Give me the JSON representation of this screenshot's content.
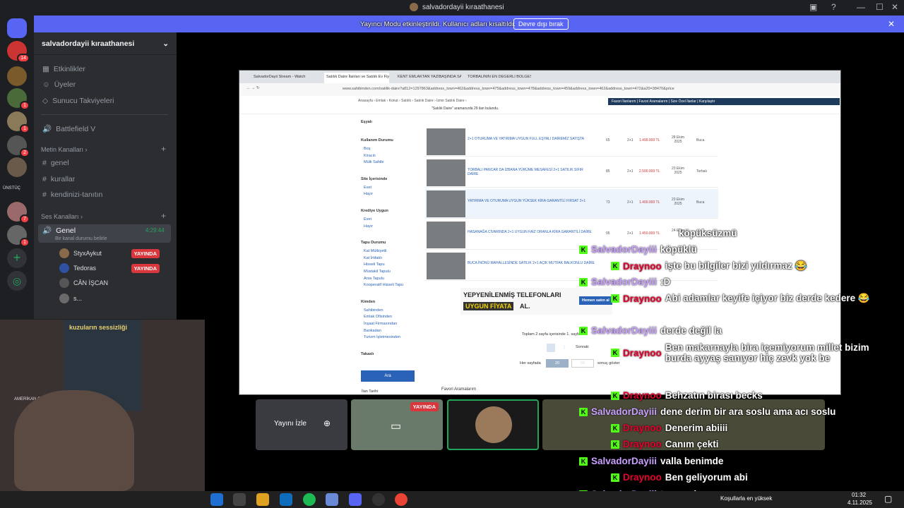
{
  "window": {
    "title": "salvadordayii kıraathanesi"
  },
  "banner": {
    "message": "Yayıncı Modu etkinleştirildi. Kullanıcı adları kısaltıldı.",
    "button": "Devre dışı bırak"
  },
  "servers": {
    "badges": [
      "14",
      "1",
      "1",
      "1",
      "2",
      "1",
      "7",
      "1"
    ],
    "server_label": "ÜNSTÜÇ"
  },
  "sidebar": {
    "server_name": "salvadordayii kıraathanesi",
    "items": [
      {
        "label": "Etkinlikler",
        "icon": "calendar-icon"
      },
      {
        "label": "Üyeler",
        "icon": "members-icon"
      },
      {
        "label": "Sunucu Takviyeleri",
        "icon": "boost-icon"
      }
    ],
    "game": "Battlefield V",
    "text_category": "Metin Kanalları",
    "text_channels": [
      "genel",
      "kurallar",
      "kendinizi-tanıtın"
    ],
    "voice_category": "Ses Kanalları",
    "voice_channel": {
      "name": "Genel",
      "time": "4:29:44",
      "status": "Bir kanal durumu belirle"
    },
    "voice_users": [
      {
        "name": "StyxAykut",
        "live": "YAYINDA"
      },
      {
        "name": "Tedoras",
        "live": "YAYINDA"
      },
      {
        "name": "CÂN İŞCAN",
        "live": ""
      },
      {
        "name": "s...",
        "live": ""
      }
    ]
  },
  "shared_screen": {
    "tabs": [
      "SalvadorDayii Stream - Watch",
      "Satılık Daire İlanları ve Satılık Ev Fiyat",
      "KENT EMLAKTAN YAZIBAŞINDA SATI",
      "TORBALININ EN DEĞERLİ BÖLGESİ"
    ],
    "url": "www.sahibinden.com/satilik-daire?a812=1297863&address_town=462&address_town=475&address_town=478&address_town=459&address_town=462&address_town=472&a20=38470&price",
    "breadcrumb": "Anasayfa › Emlak › Konut › Satılık › Satılık Daire › İzmir Satılık Daire ›",
    "result_text": "\"Satılık Daire\" aramanızda 29 ilan bulundu.",
    "top_links": "Favori İlanlarım | Favori Aramalarım | Size Özel İlanlar | Karşılaştır",
    "filters": [
      {
        "title": "Eşyalı",
        "options": []
      },
      {
        "title": "Kullanım Durumu",
        "options": [
          "Boş",
          "Kiracılı",
          "Mülk Sahibi"
        ]
      },
      {
        "title": "Site İçerisinde",
        "options": [
          "Evet",
          "Hayır"
        ]
      },
      {
        "title": "Krediye Uygun",
        "options": [
          "Evet",
          "Hayır"
        ]
      },
      {
        "title": "Tapu Durumu",
        "options": [
          "Kat Mülkiyetli",
          "Kat İrtifaklı",
          "Hisseli Tapu",
          "Müstakil Tapulu",
          "Arsa Tapulu",
          "Kooperatif Hisseli Tapu"
        ]
      },
      {
        "title": "Kimden",
        "options": [
          "Sahibinden",
          "Emlak Ofisinden",
          "İnşaat Firmasından",
          "Bankadan",
          "Turizm İşletmesinden"
        ]
      },
      {
        "title": "Takaslı",
        "options": []
      }
    ],
    "search_button": "Ara",
    "last_filter": "İlan Tarihi",
    "listings": [
      {
        "title": "2+1 OTURUMA VE YATIRIMA UYGUN FULL EŞYALI DAİREMİZ SATIŞTA",
        "m2": "65",
        "rooms": "2+1",
        "price": "1.499.000 TL",
        "date": "28 Ekim 2025",
        "loc": "Buca"
      },
      {
        "title": "TORBALI PANCAR DA İZBANA YÜRÜME MESAFESİ 2+1 SATILIK SIFIR DAİRE",
        "m2": "85",
        "rooms": "2+1",
        "price": "2.500.000 TL",
        "date": "23 Ekim 2025",
        "loc": "Torbalı"
      },
      {
        "title": "YATIRIMA VE OTURUMA UYGUN YÜKSEK KİRA GARANTİLİ FIRSAT 2+1",
        "m2": "73",
        "rooms": "2+1",
        "price": "1.400.000 TL",
        "date": "23 Ekim 2025",
        "loc": "Buca"
      },
      {
        "title": "HASANAĞA CİVARINDA 2+1 UYGUN FAİZ ORANLA KİRA GARANTİLİ DAİRE",
        "m2": "95",
        "rooms": "2+1",
        "price": "1.450.000 TL",
        "date": "24 Ekim",
        "loc": ""
      },
      {
        "title": "BUCA İNÖNÜ MAHALLESİNDE SATILIK 2+1 AÇIK MUTFAK BALKONLU DAİRE",
        "m2": "",
        "rooms": "",
        "price": "",
        "date": "",
        "loc": ""
      }
    ],
    "ad": {
      "line1": "YEPYENİLENMİŞ TELEFONLARI",
      "line2": "UYGUN FİYATA",
      "line3": "AL.",
      "button": "Hemen satın al",
      "brand": "yepy"
    },
    "pagination": {
      "summary": "Toplam 2 sayfa içerisinde 1. sayfa",
      "pages": [
        "1",
        "2"
      ],
      "next": "Sonraki",
      "per_page_label": "Her sayfada",
      "per_page": [
        "20",
        "50"
      ],
      "per_page_suffix": "sonuç göster"
    },
    "footer": "Favori Aramalarım"
  },
  "tiles": {
    "watch_label": "Yayını İzle",
    "live_badge": "YAYINDA"
  },
  "chat": [
    {
      "user": "",
      "text": "köpüksüzmü",
      "color": "#ffffff"
    },
    {
      "user": "SalvadorDayiii",
      "text": "köpüklü",
      "color": "#c9a0ff"
    },
    {
      "user": "Draynoo",
      "text": "işte bu bilgiler bizi yıldırmaz 😂",
      "color": "#e8002d"
    },
    {
      "user": "SalvadorDayiii",
      "text": ":D",
      "color": "#c9a0ff"
    },
    {
      "user": "Draynoo",
      "text": "Abi adamlar keyife içiyor biz derde kedere 😂",
      "color": "#e8002d"
    },
    {
      "user": "SalvadorDayiii",
      "text": "derde değil la",
      "color": "#c9a0ff"
    },
    {
      "user": "Draynoo",
      "text": "Ben makarnayla bira içemiyorum millet bizim burda ayyaş sanıyor hiç zevk yok be",
      "color": "#e8002d"
    },
    {
      "user": "Draynoo",
      "text": "Behzatın birası becks",
      "color": "#e8002d"
    },
    {
      "user": "SalvadorDayiii",
      "text": "dene derim bir ara soslu ama acı soslu",
      "color": "#c9a0ff"
    },
    {
      "user": "Draynoo",
      "text": "Denerim abiiii",
      "color": "#e8002d"
    },
    {
      "user": "Draynoo",
      "text": "Canım çekti",
      "color": "#e8002d"
    },
    {
      "user": "SalvadorDayiii",
      "text": "valla benimde",
      "color": "#c9a0ff"
    },
    {
      "user": "Draynoo",
      "text": "Ben geliyorum abi",
      "color": "#e8002d"
    },
    {
      "user": "SalvadorDayiii",
      "text": "tamam koçum",
      "color": "#c9a0ff"
    }
  ],
  "taskbar": {
    "weather": "Koşullarla en yüksek",
    "time": "01:32",
    "date": "4.11.2025"
  },
  "webcam_poster": {
    "title": "kuzuların sessizliği",
    "subtitle": "AMERİKAN GANGSTER"
  }
}
